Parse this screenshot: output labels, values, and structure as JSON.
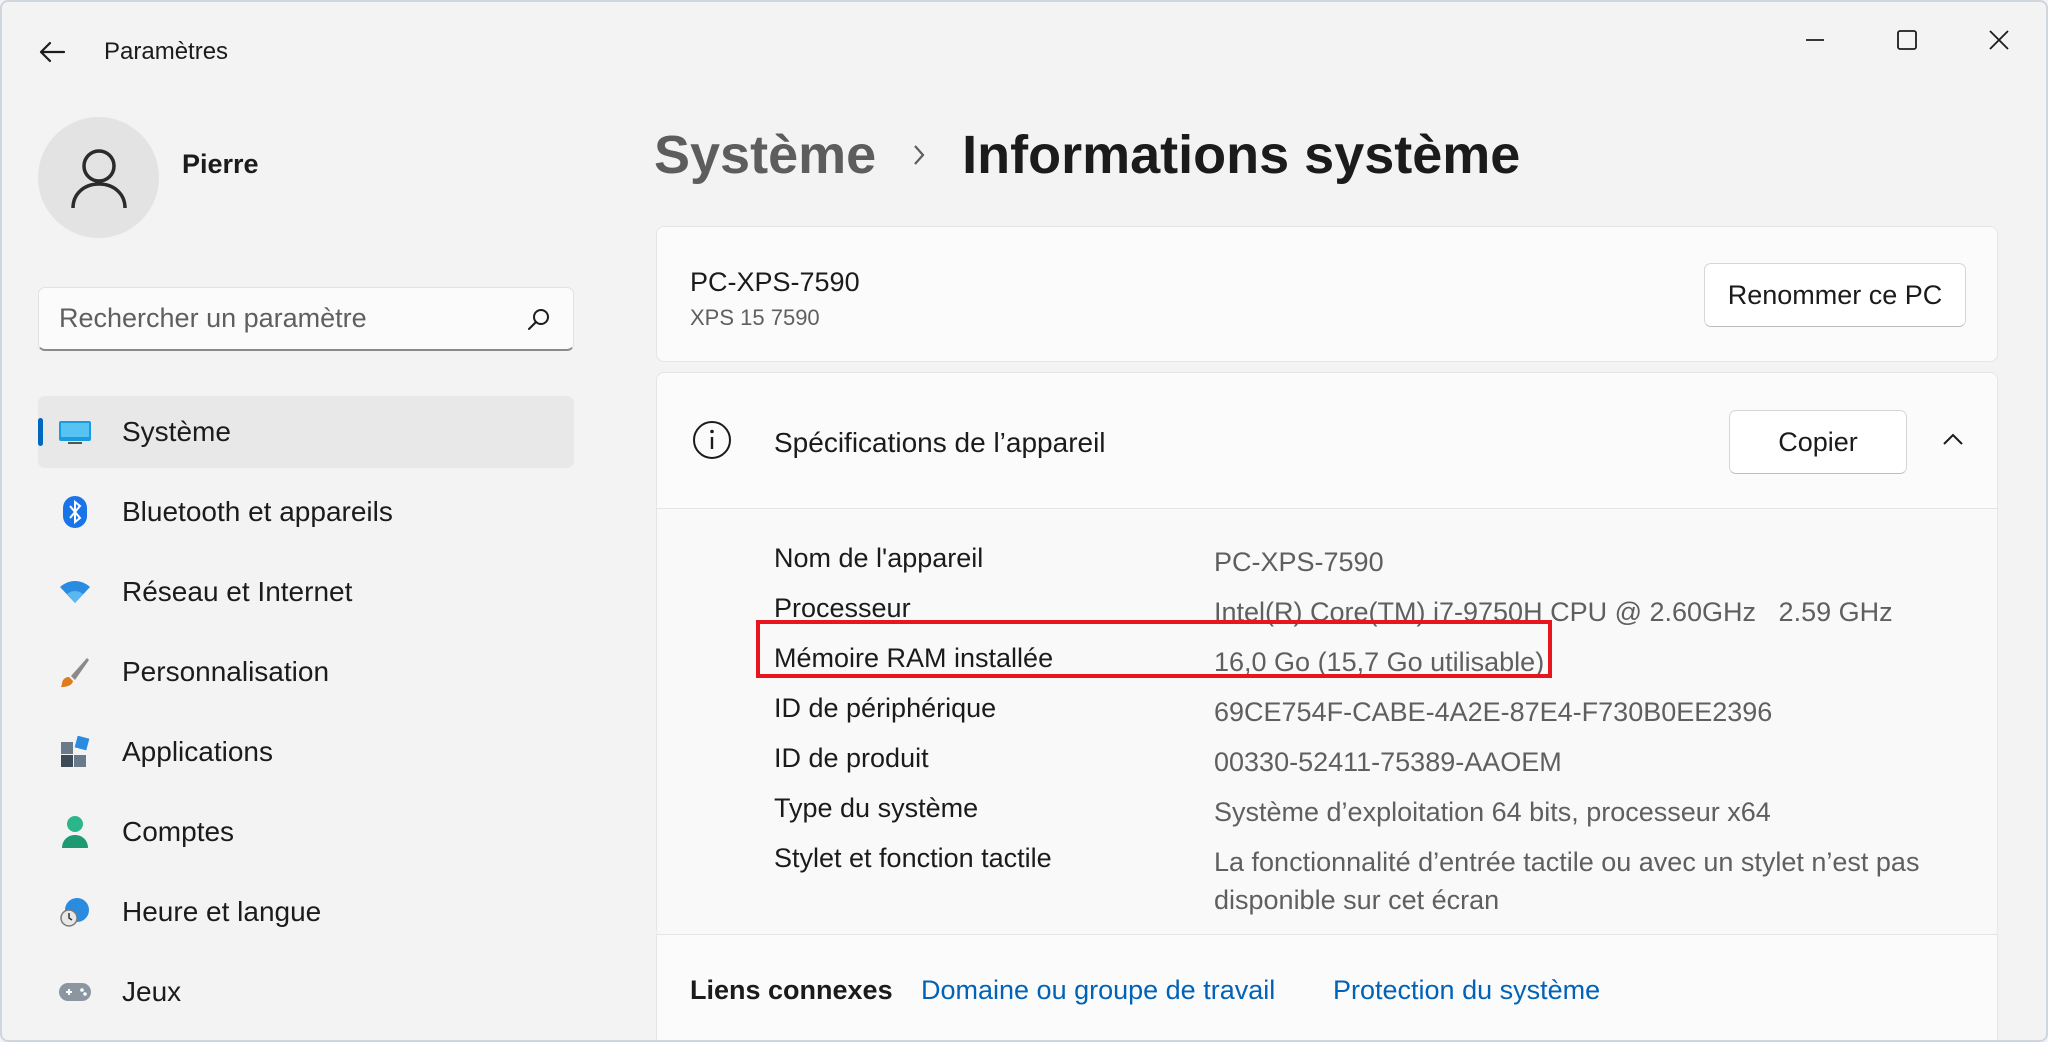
{
  "window": {
    "title": "Paramètres"
  },
  "user": {
    "name": "Pierre"
  },
  "search": {
    "placeholder": "Rechercher un paramètre"
  },
  "sidebar": {
    "items": [
      {
        "label": "Système",
        "icon": "system-icon",
        "active": true
      },
      {
        "label": "Bluetooth et appareils",
        "icon": "bluetooth-icon"
      },
      {
        "label": "Réseau et Internet",
        "icon": "wifi-icon"
      },
      {
        "label": "Personnalisation",
        "icon": "brush-icon"
      },
      {
        "label": "Applications",
        "icon": "apps-icon"
      },
      {
        "label": "Comptes",
        "icon": "person-icon"
      },
      {
        "label": "Heure et langue",
        "icon": "globe-clock-icon"
      },
      {
        "label": "Jeux",
        "icon": "gamepad-icon"
      }
    ]
  },
  "breadcrumb": {
    "parent": "Système",
    "current": "Informations système"
  },
  "pc": {
    "name": "PC-XPS-7590",
    "model": "XPS 15 7590",
    "rename_label": "Renommer ce PC"
  },
  "specs": {
    "title": "Spécifications de l’appareil",
    "copy_label": "Copier",
    "rows": [
      {
        "key": "Nom de l'appareil",
        "value": "PC-XPS-7590"
      },
      {
        "key": "Processeur",
        "value": "Intel(R) Core(TM) i7-9750H CPU @ 2.60GHz   2.59 GHz"
      },
      {
        "key": "Mémoire RAM installée",
        "value": "16,0 Go (15,7 Go utilisable)"
      },
      {
        "key": "ID de périphérique",
        "value": "69CE754F-CABE-4A2E-87E4-F730B0EE2396"
      },
      {
        "key": "ID de produit",
        "value": "00330-52411-75389-AAOEM"
      },
      {
        "key": "Type du système",
        "value": "Système d’exploitation 64 bits, processeur x64"
      },
      {
        "key": "Stylet et fonction tactile",
        "value": "La fonctionnalité d’entrée tactile ou avec un stylet n’est pas disponible sur cet écran"
      }
    ]
  },
  "related": {
    "title": "Liens connexes",
    "links": [
      "Domaine ou groupe de travail",
      "Protection du système"
    ]
  },
  "colors": {
    "accent": "#0067c0",
    "link": "#0062b8",
    "highlight": "#e8141e"
  }
}
